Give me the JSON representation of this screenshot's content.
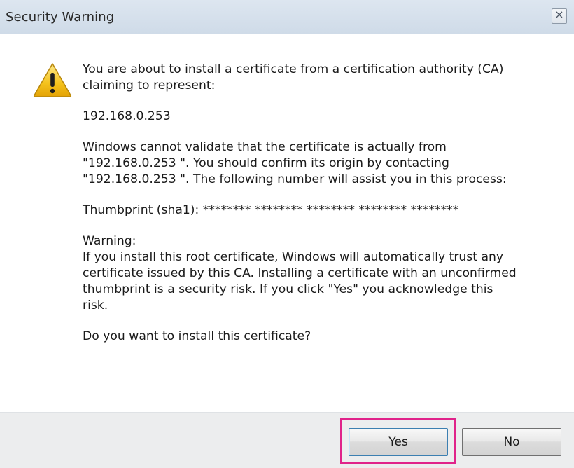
{
  "window": {
    "title": "Security Warning",
    "close_symbol": "×"
  },
  "icons": {
    "warning": "warning-icon",
    "close": "close-icon"
  },
  "message": {
    "intro_line1": "You are about to install a certificate from a certification authority (CA)",
    "intro_line2": "claiming to represent:",
    "host": "192.168.0.253",
    "validate_line1": "Windows cannot validate that the certificate is actually from",
    "validate_line2": "\"192.168.0.253 \". You should confirm its origin by contacting",
    "validate_line3": "\"192.168.0.253 \". The following number will assist you in this process:",
    "thumbprint": "Thumbprint (sha1): ******** ******** ******** ******** ********",
    "warning_title": "Warning:",
    "warning_line1": "If you install this root certificate, Windows will automatically trust any",
    "warning_line2": "certificate issued by this CA. Installing a certificate with an unconfirmed",
    "warning_line3": "thumbprint is a security risk. If you click \"Yes\" you acknowledge this",
    "warning_line4": "risk.",
    "question": "Do you want to install this certificate?"
  },
  "buttons": {
    "yes": "Yes",
    "no": "No"
  },
  "colors": {
    "highlight": "#e0238a",
    "titlebar": "#d6e0eb",
    "footer": "#ecedee"
  }
}
